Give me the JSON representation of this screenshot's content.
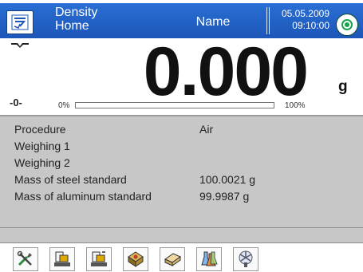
{
  "header": {
    "title_line1": "Density",
    "title_line2": "Home",
    "user": "Name",
    "date": "05.05.2009",
    "time": "09:10:00"
  },
  "reading": {
    "value": "0.000",
    "unit": "g",
    "zero_indicator": "-0-",
    "range_min": "0%",
    "range_max": "100%",
    "load_percent": 0
  },
  "info": {
    "rows": [
      {
        "label": "Procedure",
        "value": "Air"
      },
      {
        "label": "Weighing 1",
        "value": ""
      },
      {
        "label": "Weighing 2",
        "value": ""
      },
      {
        "label": "Mass of steel standard",
        "value": "100.0021 g"
      },
      {
        "label": "Mass of aluminum standard",
        "value": "99.9987 g"
      }
    ]
  },
  "toolbar": {
    "buttons": [
      "tools-icon",
      "tare-icon",
      "tare-set-icon",
      "sample-icon",
      "sinker-icon",
      "liquids-icon",
      "fan-icon"
    ]
  },
  "colors": {
    "header": "#1f5fc4",
    "panel": "#c7c7c7",
    "status_ok": "#17a34a"
  }
}
